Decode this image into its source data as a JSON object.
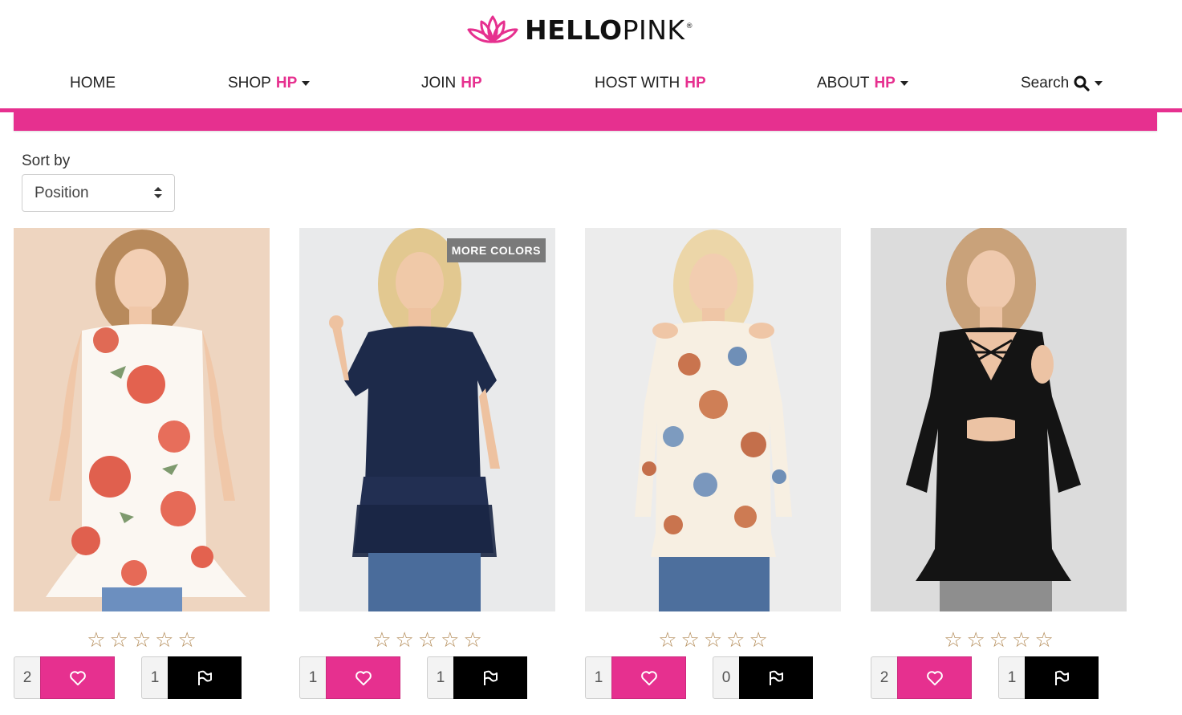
{
  "brand": {
    "logo_bold": "HELLO",
    "logo_thin": "PINK",
    "logo_reg": "®",
    "accent": "#e6308f"
  },
  "nav": {
    "home": "HOME",
    "shop": "SHOP",
    "shop_hp": "HP",
    "join": "JOIN",
    "join_hp": "HP",
    "host": "HOST WITH",
    "host_hp": "HP",
    "about": "ABOUT",
    "about_hp": "HP",
    "search": "Search"
  },
  "sort": {
    "label": "Sort by",
    "selected": "Position"
  },
  "products": [
    {
      "image": "woman-sleeveless-floral-ruffle-top",
      "badge": "",
      "rating": 0,
      "likes": "2",
      "flags": "1"
    },
    {
      "image": "woman-navy-short-sleeve-ruffle-top",
      "badge": "MORE COLORS",
      "rating": 0,
      "likes": "1",
      "flags": "1"
    },
    {
      "image": "woman-cold-shoulder-floral-top",
      "badge": "",
      "rating": 0,
      "likes": "1",
      "flags": "0"
    },
    {
      "image": "woman-black-lattice-cold-shoulder-top",
      "badge": "",
      "rating": 0,
      "likes": "2",
      "flags": "1"
    }
  ],
  "icons": {
    "like": "heart-icon",
    "flag": "flag-icon",
    "search": "search-icon",
    "star": "star-outline-icon"
  },
  "colors": {
    "pink": "#e6308f",
    "star": "#b58e5c",
    "flag_bg": "#000000"
  }
}
